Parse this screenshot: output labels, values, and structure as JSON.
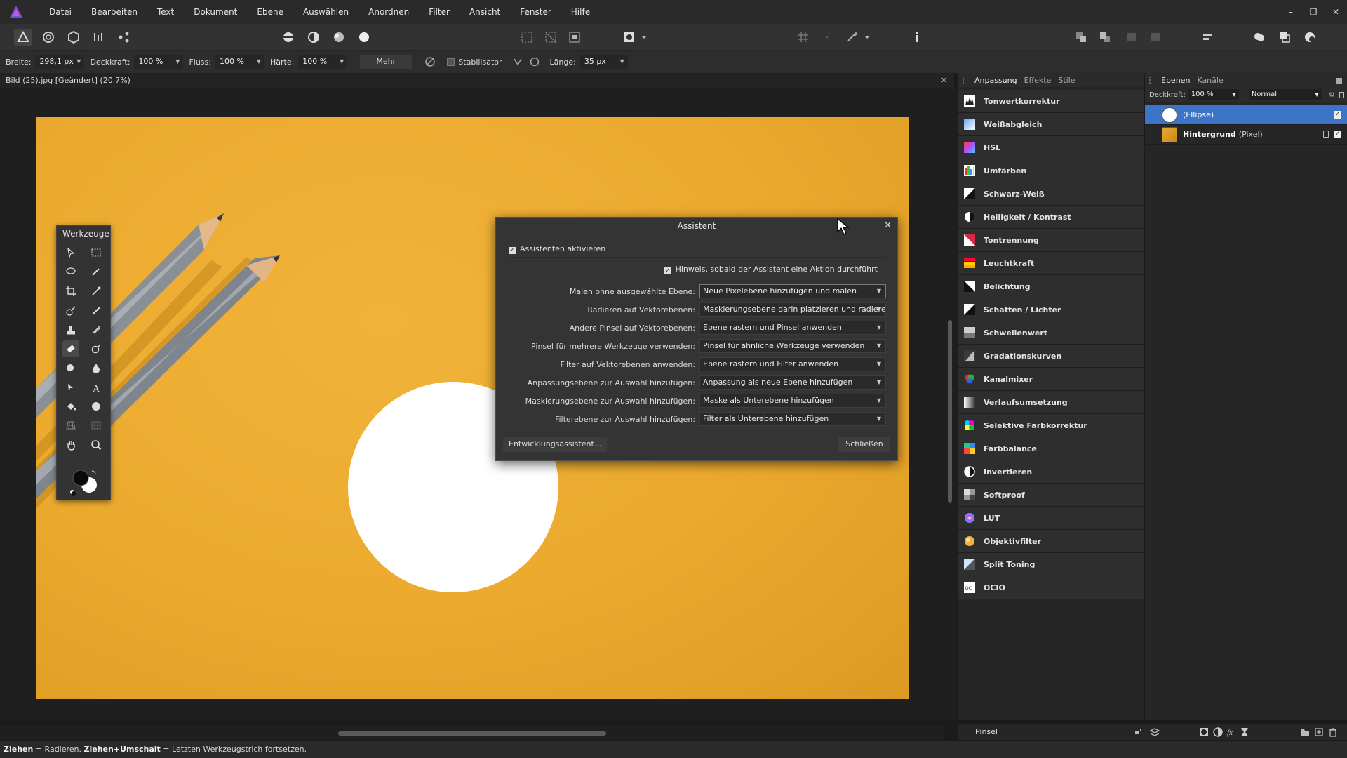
{
  "menu": [
    "Datei",
    "Bearbeiten",
    "Text",
    "Dokument",
    "Ebene",
    "Auswählen",
    "Anordnen",
    "Filter",
    "Ansicht",
    "Fenster",
    "Hilfe"
  ],
  "window_controls": [
    "–",
    "❐",
    "✕"
  ],
  "context_bar": {
    "width_label": "Breite:",
    "width_value": "298,1 px",
    "opacity_label": "Deckkraft:",
    "opacity_value": "100 %",
    "flow_label": "Fluss:",
    "flow_value": "100 %",
    "hardness_label": "Härte:",
    "hardness_value": "100 %",
    "more_button": "Mehr",
    "stabilizer_label": "Stabilisator",
    "length_label": "Länge:",
    "length_value": "35 px"
  },
  "document": {
    "tab_title": "Bild (25).jpg [Geändert] (20.7%)",
    "close": "✕"
  },
  "tools_panel": {
    "title": "Werkzeuge"
  },
  "assistant": {
    "title": "Assistent",
    "close": "✕",
    "enable_label": "Assistenten aktivieren",
    "hint_label": "Hinweis, sobald der Assistent eine Aktion durchführt",
    "rows": [
      {
        "label": "Malen ohne ausgewählte Ebene:",
        "value": "Neue Pixelebene hinzufügen und malen"
      },
      {
        "label": "Radieren auf Vektorebenen:",
        "value": "Maskierungsebene darin platzieren und radieren"
      },
      {
        "label": "Andere Pinsel auf Vektorebenen:",
        "value": "Ebene rastern und Pinsel anwenden"
      },
      {
        "label": "Pinsel für mehrere Werkzeuge verwenden:",
        "value": "Pinsel für ähnliche Werkzeuge verwenden"
      },
      {
        "label": "Filter auf Vektorebenen anwenden:",
        "value": "Ebene rastern und Filter anwenden"
      },
      {
        "label": "Anpassungsebene zur Auswahl hinzufügen:",
        "value": "Anpassung als neue Ebene hinzufügen"
      },
      {
        "label": "Maskierungsebene zur Auswahl hinzufügen:",
        "value": "Maske als Unterebene hinzufügen"
      },
      {
        "label": "Filterebene zur Auswahl hinzufügen:",
        "value": "Filter als Unterebene hinzufügen"
      }
    ],
    "dev_button": "Entwicklungsassistent...",
    "close_button": "Schließen"
  },
  "adjust_panel": {
    "tabs": [
      "Anpassung",
      "Effekte",
      "Stile"
    ],
    "items": [
      "Tonwertkorrektur",
      "Weißabgleich",
      "HSL",
      "Umfärben",
      "Schwarz-Weiß",
      "Helligkeit / Kontrast",
      "Tontrennung",
      "Leuchtkraft",
      "Belichtung",
      "Schatten / Lichter",
      "Schwellenwert",
      "Gradationskurven",
      "Kanalmixer",
      "Verlaufsumsetzung",
      "Selektive Farbkorrektur",
      "Farbbalance",
      "Invertieren",
      "Softproof",
      "LUT",
      "Objektivfilter",
      "Split Toning",
      "OCIO"
    ]
  },
  "layers_panel": {
    "tabs": [
      "Ebenen",
      "Kanäle"
    ],
    "opacity_label": "Deckkraft:",
    "opacity_value": "100 %",
    "blend_mode": "Normal",
    "layers": [
      {
        "name": "(Ellipse)",
        "type": ""
      },
      {
        "name": "Hintergrund",
        "type": "(Pixel)"
      }
    ]
  },
  "bottom_panel": {
    "label": "Pinsel"
  },
  "status": {
    "b1": "Ziehen",
    "t1": " = Radieren. ",
    "b2": "Ziehen+Umschalt",
    "t2": " = Letzten Werkzeugstrich fortsetzen."
  },
  "colors": {
    "accent": "#3c74c8",
    "background_photo": "#eba92d",
    "logo": "#7b4dd6"
  }
}
